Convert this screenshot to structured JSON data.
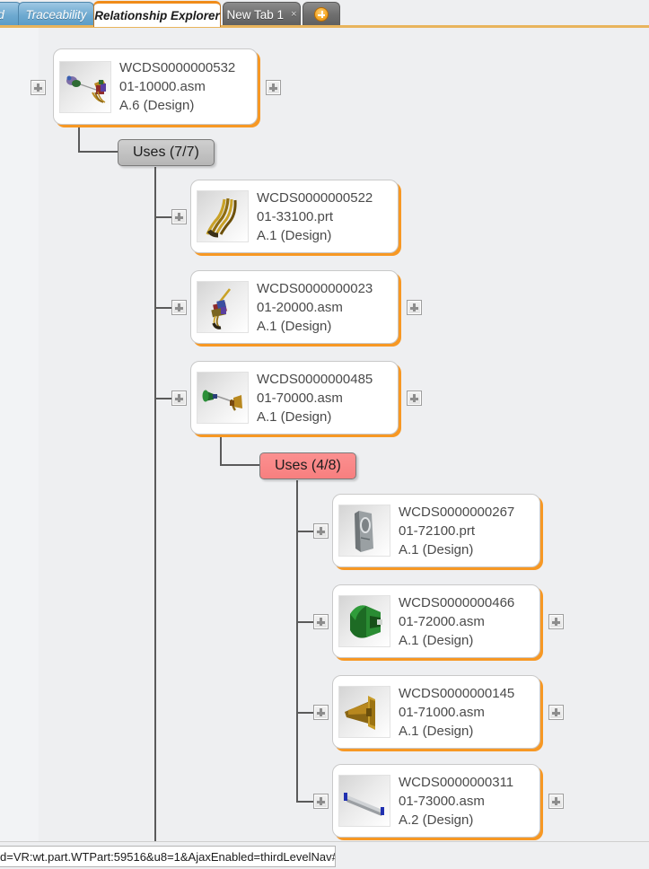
{
  "window": {
    "background_color": "#eeeff1",
    "accent_color": "#f08c1a"
  },
  "tabbar": {
    "tabs": [
      {
        "label": "d",
        "state": "partial",
        "style": "blue"
      },
      {
        "label": "Traceability",
        "state": "inactive",
        "style": "blue"
      },
      {
        "label": "Relationship Explorer",
        "state": "active",
        "style": "white"
      },
      {
        "label": "New Tab 1",
        "state": "inactive",
        "style": "gray",
        "close_label": "×"
      }
    ],
    "add_tab_label": "add-tab",
    "add_tab_icon": "plus-circle-icon"
  },
  "tree": {
    "root": {
      "id": "WCDS0000000532",
      "number": "01-10000.asm",
      "revision": "A.6 (Design)",
      "thumbnail": "assembly-multicolor-thumb",
      "left_expander": "+",
      "right_expander": "+"
    },
    "root_relationship": {
      "label": "Uses (7/7)",
      "color": "#c3c3c3",
      "style": "gray"
    },
    "level2": [
      {
        "id": "WCDS0000000522",
        "number": "01-33100.prt",
        "revision": "A.1 (Design)",
        "thumbnail": "cable-harness-thumb",
        "left_expander": "+",
        "right_expander": null
      },
      {
        "id": "WCDS0000000023",
        "number": "01-20000.asm",
        "revision": "A.1 (Design)",
        "thumbnail": "connector-assembly-thumb",
        "left_expander": "+",
        "right_expander": "+"
      },
      {
        "id": "WCDS0000000485",
        "number": "01-70000.asm",
        "revision": "A.1 (Design)",
        "thumbnail": "shaft-assembly-thumb",
        "left_expander": "+",
        "right_expander": "+"
      }
    ],
    "level2_relationship": {
      "label": "Uses (4/8)",
      "color": "#f87f7f",
      "style": "pink"
    },
    "level3": [
      {
        "id": "WCDS0000000267",
        "number": "01-72100.prt",
        "revision": "A.1 (Design)",
        "thumbnail": "bracket-plate-thumb",
        "left_expander": "+",
        "right_expander": null
      },
      {
        "id": "WCDS0000000466",
        "number": "01-72000.asm",
        "revision": "A.1 (Design)",
        "thumbnail": "green-housing-thumb",
        "left_expander": "+",
        "right_expander": "+"
      },
      {
        "id": "WCDS0000000145",
        "number": "01-71000.asm",
        "revision": "A.1 (Design)",
        "thumbnail": "gold-cone-thumb",
        "left_expander": "+",
        "right_expander": "+"
      },
      {
        "id": "WCDS0000000311",
        "number": "01-73000.asm",
        "revision": "A.2 (Design)",
        "thumbnail": "silver-rod-thumb",
        "left_expander": "+",
        "right_expander": "+"
      }
    ]
  },
  "statusbar": {
    "url_text": "d=VR:wt.part.WTPart:59516&u8=1&AjaxEnabled=thirdLevelNav#"
  }
}
